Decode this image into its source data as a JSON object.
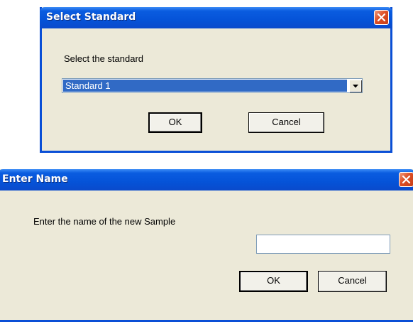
{
  "select_dialog": {
    "title": "Select Standard",
    "prompt": "Select the standard",
    "dropdown": {
      "selected": "Standard 1"
    },
    "ok_label": "OK",
    "cancel_label": "Cancel"
  },
  "name_dialog": {
    "title": "Enter Name",
    "prompt": "Enter the name of the new Sample",
    "name_input": {
      "value": ""
    },
    "ok_label": "OK",
    "cancel_label": "Cancel"
  },
  "colors": {
    "titlebar": "#0553d8",
    "dialog_face": "#ece9d8",
    "selection": "#316ac5",
    "close_button": "#dd4e24"
  },
  "icons": {
    "close": "close-icon",
    "dropdown": "chevron-down-icon"
  }
}
